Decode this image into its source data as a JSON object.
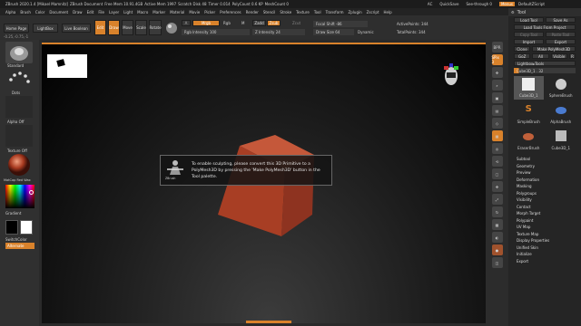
{
  "titlebar": {
    "items": [
      "ZBrush 2020.1.4 [Mikael Mamnitz]",
      "ZBrush Document",
      "Free Mem 10.91.4GB",
      "Active Mem 1997",
      "Scratch Disk 48",
      "Timer 0.014",
      "PolyCount 0.6 KP",
      "MeshCount 0"
    ],
    "right": [
      "AC",
      "QuickSave",
      "See-through 0",
      "Menus",
      "DefaultZScript"
    ]
  },
  "menubar": {
    "items": [
      "Alpha",
      "Brush",
      "Color",
      "Document",
      "Draw",
      "Edit",
      "File",
      "Layer",
      "Light",
      "Macro",
      "Marker",
      "Material",
      "Movie",
      "Picker",
      "Preferences",
      "Render",
      "Stencil",
      "Stroke",
      "Texture",
      "Tool",
      "Transform",
      "Zplugin",
      "Zscript",
      "Help"
    ]
  },
  "toolbar": {
    "home_page": "Home Page",
    "lightbox": "LightBox",
    "live_boolean": "Live Boolean",
    "modes": [
      "Edit",
      "Draw",
      "Move",
      "Scale",
      "Rotate"
    ],
    "mrgb": "Mrgb",
    "rgb": "Rgb",
    "m": "M",
    "rgb_intensity_label": "Rgb Intensity",
    "rgb_intensity": "100",
    "zadd": "Zadd",
    "zsub": "Zsub",
    "zcut": "Zcut",
    "z_intensity_label": "Z Intensity",
    "z_intensity": "24",
    "focal_shift_label": "Focal Shift",
    "focal_shift": "-86",
    "draw_size_label": "Draw Size",
    "draw_size": "64",
    "dynamic": "Dynamic",
    "active_points_label": "ActivePoints:",
    "active_points": "344",
    "total_points_label": "TotalPoints:",
    "total_points": "344",
    "coords": "-0.25,-0.75,-1"
  },
  "leftshelf": {
    "brush": "Standard",
    "stroke": "Dots",
    "alpha": "Alpha Off",
    "texture": "Texture Off",
    "material": "MatCap Red Wax",
    "gradient": "Gradient",
    "switch_color": "SwitchColor",
    "alternate": "Alternate"
  },
  "canvas": {
    "message": "To enable sculpting, please convert this 3D Primitive to a PolyMesh3D by pressing the 'Make PolyMesh3D' button in the Tool palette.",
    "logo": "ZBrush"
  },
  "rightshelf": [
    "BPR",
    "SPix 3",
    "Scroll",
    "Zoom",
    "Actual",
    "AAHalf",
    "Dynamic",
    "Persp",
    "Floor",
    "Local",
    "Frame",
    "Move",
    "Scale",
    "Rotate",
    "Line Fill",
    "PolyF",
    "Transp",
    "Ghost",
    "Solo",
    "Xpose"
  ],
  "toolpanel": {
    "title": "Tool",
    "buttons": [
      [
        "Load Tool",
        "Save As"
      ],
      [
        "Load Tools From Project",
        ""
      ],
      [
        "Copy Tool",
        "Paste Tool"
      ],
      [
        "Import",
        "Export"
      ],
      [
        "Clone",
        "Make PolyMesh3D"
      ],
      [
        "GoZ",
        "All",
        "Visible",
        "R"
      ]
    ],
    "lightbox_tools": "Lightbox▸Tools",
    "slider": "Cube3D_1 . 32",
    "thumbs": [
      "Cube3D_1",
      "SphereBrush",
      "AlphaBrush",
      "SimpleBrush",
      "EraserBrush",
      "Cube3D_1"
    ],
    "items": [
      "Subtool",
      "Geometry",
      "Preview",
      "Deformation",
      "Masking",
      "Polygroups",
      "Visibility",
      "Contact",
      "Morph Target",
      "Polypaint",
      "UV Map",
      "Texture Map",
      "Display Properties",
      "Unified Skin",
      "Initialize",
      "Export"
    ]
  },
  "colors": {
    "accent": "#d9822b",
    "cube": "#b5432a"
  }
}
